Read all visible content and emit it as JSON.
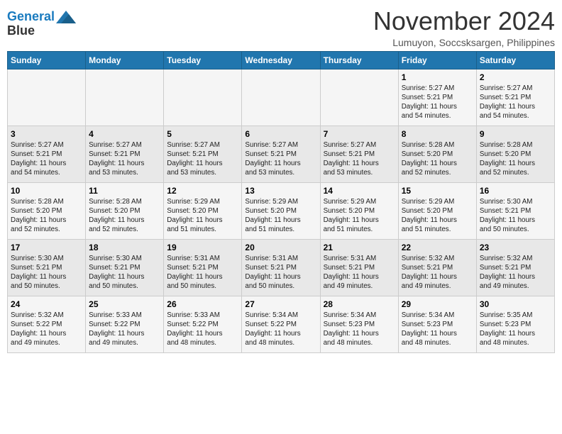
{
  "logo": {
    "line1": "General",
    "line2": "Blue"
  },
  "title": "November 2024",
  "subtitle": "Lumuyon, Soccsksargen, Philippines",
  "weekdays": [
    "Sunday",
    "Monday",
    "Tuesday",
    "Wednesday",
    "Thursday",
    "Friday",
    "Saturday"
  ],
  "weeks": [
    [
      {
        "day": "",
        "info": ""
      },
      {
        "day": "",
        "info": ""
      },
      {
        "day": "",
        "info": ""
      },
      {
        "day": "",
        "info": ""
      },
      {
        "day": "",
        "info": ""
      },
      {
        "day": "1",
        "info": "Sunrise: 5:27 AM\nSunset: 5:21 PM\nDaylight: 11 hours\nand 54 minutes."
      },
      {
        "day": "2",
        "info": "Sunrise: 5:27 AM\nSunset: 5:21 PM\nDaylight: 11 hours\nand 54 minutes."
      }
    ],
    [
      {
        "day": "3",
        "info": "Sunrise: 5:27 AM\nSunset: 5:21 PM\nDaylight: 11 hours\nand 54 minutes."
      },
      {
        "day": "4",
        "info": "Sunrise: 5:27 AM\nSunset: 5:21 PM\nDaylight: 11 hours\nand 53 minutes."
      },
      {
        "day": "5",
        "info": "Sunrise: 5:27 AM\nSunset: 5:21 PM\nDaylight: 11 hours\nand 53 minutes."
      },
      {
        "day": "6",
        "info": "Sunrise: 5:27 AM\nSunset: 5:21 PM\nDaylight: 11 hours\nand 53 minutes."
      },
      {
        "day": "7",
        "info": "Sunrise: 5:27 AM\nSunset: 5:21 PM\nDaylight: 11 hours\nand 53 minutes."
      },
      {
        "day": "8",
        "info": "Sunrise: 5:28 AM\nSunset: 5:20 PM\nDaylight: 11 hours\nand 52 minutes."
      },
      {
        "day": "9",
        "info": "Sunrise: 5:28 AM\nSunset: 5:20 PM\nDaylight: 11 hours\nand 52 minutes."
      }
    ],
    [
      {
        "day": "10",
        "info": "Sunrise: 5:28 AM\nSunset: 5:20 PM\nDaylight: 11 hours\nand 52 minutes."
      },
      {
        "day": "11",
        "info": "Sunrise: 5:28 AM\nSunset: 5:20 PM\nDaylight: 11 hours\nand 52 minutes."
      },
      {
        "day": "12",
        "info": "Sunrise: 5:29 AM\nSunset: 5:20 PM\nDaylight: 11 hours\nand 51 minutes."
      },
      {
        "day": "13",
        "info": "Sunrise: 5:29 AM\nSunset: 5:20 PM\nDaylight: 11 hours\nand 51 minutes."
      },
      {
        "day": "14",
        "info": "Sunrise: 5:29 AM\nSunset: 5:20 PM\nDaylight: 11 hours\nand 51 minutes."
      },
      {
        "day": "15",
        "info": "Sunrise: 5:29 AM\nSunset: 5:20 PM\nDaylight: 11 hours\nand 51 minutes."
      },
      {
        "day": "16",
        "info": "Sunrise: 5:30 AM\nSunset: 5:21 PM\nDaylight: 11 hours\nand 50 minutes."
      }
    ],
    [
      {
        "day": "17",
        "info": "Sunrise: 5:30 AM\nSunset: 5:21 PM\nDaylight: 11 hours\nand 50 minutes."
      },
      {
        "day": "18",
        "info": "Sunrise: 5:30 AM\nSunset: 5:21 PM\nDaylight: 11 hours\nand 50 minutes."
      },
      {
        "day": "19",
        "info": "Sunrise: 5:31 AM\nSunset: 5:21 PM\nDaylight: 11 hours\nand 50 minutes."
      },
      {
        "day": "20",
        "info": "Sunrise: 5:31 AM\nSunset: 5:21 PM\nDaylight: 11 hours\nand 50 minutes."
      },
      {
        "day": "21",
        "info": "Sunrise: 5:31 AM\nSunset: 5:21 PM\nDaylight: 11 hours\nand 49 minutes."
      },
      {
        "day": "22",
        "info": "Sunrise: 5:32 AM\nSunset: 5:21 PM\nDaylight: 11 hours\nand 49 minutes."
      },
      {
        "day": "23",
        "info": "Sunrise: 5:32 AM\nSunset: 5:21 PM\nDaylight: 11 hours\nand 49 minutes."
      }
    ],
    [
      {
        "day": "24",
        "info": "Sunrise: 5:32 AM\nSunset: 5:22 PM\nDaylight: 11 hours\nand 49 minutes."
      },
      {
        "day": "25",
        "info": "Sunrise: 5:33 AM\nSunset: 5:22 PM\nDaylight: 11 hours\nand 49 minutes."
      },
      {
        "day": "26",
        "info": "Sunrise: 5:33 AM\nSunset: 5:22 PM\nDaylight: 11 hours\nand 48 minutes."
      },
      {
        "day": "27",
        "info": "Sunrise: 5:34 AM\nSunset: 5:22 PM\nDaylight: 11 hours\nand 48 minutes."
      },
      {
        "day": "28",
        "info": "Sunrise: 5:34 AM\nSunset: 5:23 PM\nDaylight: 11 hours\nand 48 minutes."
      },
      {
        "day": "29",
        "info": "Sunrise: 5:34 AM\nSunset: 5:23 PM\nDaylight: 11 hours\nand 48 minutes."
      },
      {
        "day": "30",
        "info": "Sunrise: 5:35 AM\nSunset: 5:23 PM\nDaylight: 11 hours\nand 48 minutes."
      }
    ]
  ]
}
